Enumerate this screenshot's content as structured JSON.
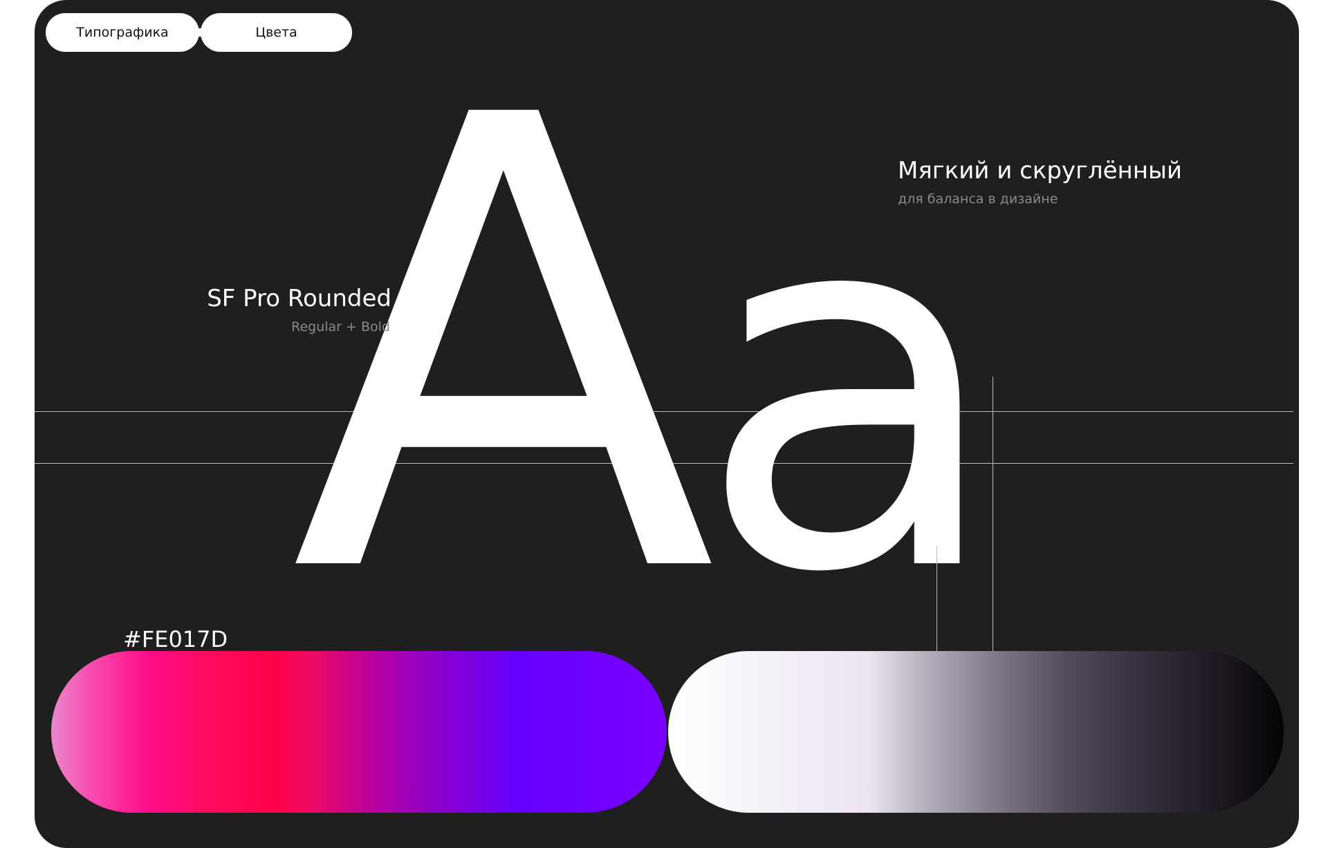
{
  "tabs": [
    {
      "label": "Типографика"
    },
    {
      "label": "Цвета"
    }
  ],
  "specimen": {
    "glyphs": "Aa",
    "upper": "A",
    "lower": "a"
  },
  "font": {
    "name": "SF Pro Rounded",
    "weights": "Regular + Bold"
  },
  "tagline": {
    "title": "Мягкий и скруглённый",
    "subtitle": "для баланса в дизайне"
  },
  "colors": {
    "primary_label": "#FE017D",
    "background": "#1f1f1f",
    "text": "#ffffff",
    "muted_text": "#8a8a8a"
  }
}
